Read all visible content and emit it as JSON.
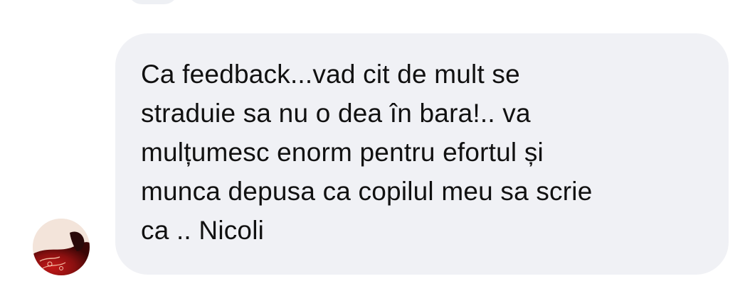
{
  "message": {
    "text": "Ca feedback...vad cit de mult se\nstraduie sa nu o dea în bara!.. va\nmulțumesc enorm pentru efortul și\nmunca depusa ca copilul meu sa scrie\nca .. Nicoli"
  },
  "avatar": {
    "icon": "profile-avatar"
  },
  "colors": {
    "bubble": "#f0f1f5",
    "text": "#111111",
    "background": "#ffffff"
  }
}
